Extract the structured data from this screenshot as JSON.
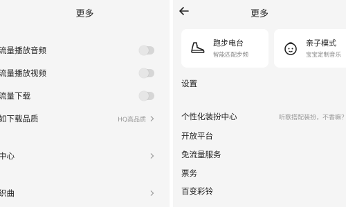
{
  "left": {
    "title": "更多",
    "rows": [
      {
        "label": "流量播放音频",
        "toggle": false
      },
      {
        "label": "流量播放视频",
        "toggle": false
      },
      {
        "label": "流量下载",
        "toggle": false
      },
      {
        "label": "如下载品质",
        "value": "HQ高品质"
      },
      {
        "label": "中心"
      },
      {
        "label": "织曲"
      }
    ]
  },
  "right": {
    "title": "更多",
    "cards": [
      {
        "title": "跑步电台",
        "subtitle": "智能匹配步频",
        "icon": "sneaker-icon"
      },
      {
        "title": "亲子模式",
        "subtitle": "宝宝定制音乐",
        "icon": "child-face-icon"
      }
    ],
    "section_label": "设置",
    "rows": [
      {
        "label": "个性化装扮中心",
        "value": "听歌搭配装扮，不香嘛？"
      },
      {
        "label": "开放平台"
      },
      {
        "label": "免流量服务"
      },
      {
        "label": "票务"
      },
      {
        "label": "百变彩铃"
      }
    ]
  },
  "colors": {
    "background": "#f5f5f5",
    "card": "#ffffff",
    "toggle_off": "#d6d6d6",
    "secondary_text": "#999999"
  }
}
